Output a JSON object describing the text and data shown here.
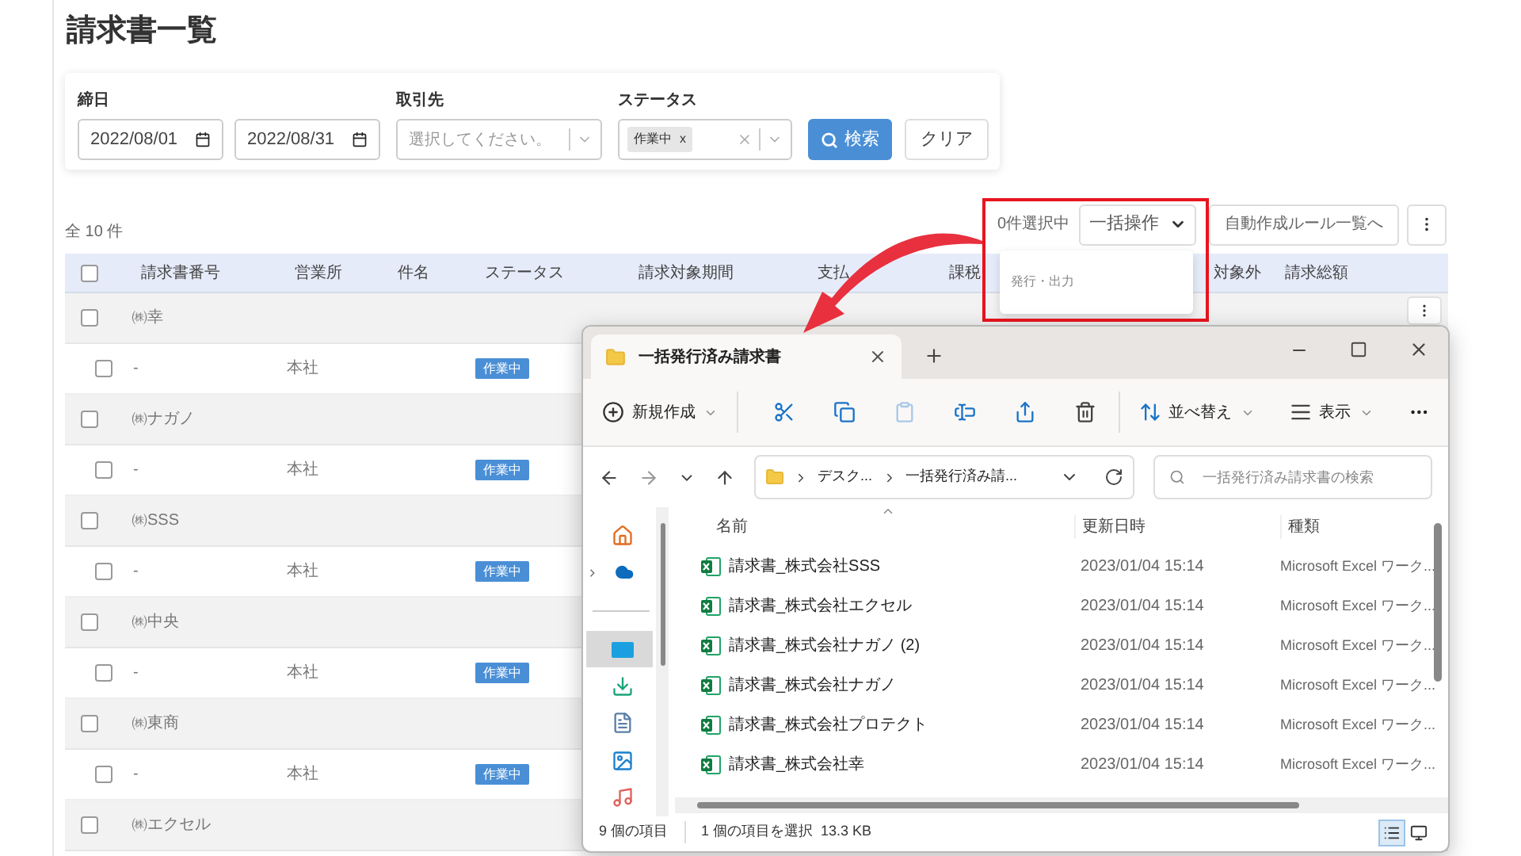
{
  "page": {
    "title": "請求書一覧"
  },
  "filters": {
    "closing_date": {
      "label": "締日",
      "from": "2022/08/01",
      "to": "2022/08/31"
    },
    "client": {
      "label": "取引先",
      "placeholder": "選択してください。"
    },
    "status": {
      "label": "ステータス",
      "tags": [
        {
          "label": "作業中",
          "remove": "x"
        }
      ]
    },
    "search_button": "検索",
    "clear_button": "クリア"
  },
  "total": "全 10 件",
  "toolbar": {
    "selected_count": "0件選択中",
    "bulk_button": "一括操作",
    "rules_button": "自動作成ルール一覧へ"
  },
  "bulk_menu": {
    "expanded": true,
    "items": [
      "発行・出力"
    ]
  },
  "table": {
    "header_checked": false,
    "columns": [
      "請求書番号",
      "営業所",
      "件名",
      "ステータス",
      "請求対象期間",
      "支払",
      "課税",
      "対象外",
      "請求総額"
    ],
    "rows": [
      {
        "kind": "group",
        "name": "㈱幸",
        "checked": false,
        "has_menu": true
      },
      {
        "kind": "item",
        "number": "-",
        "office": "本社",
        "status": "作業中",
        "checked": false
      },
      {
        "kind": "group",
        "name": "㈱ナガノ",
        "checked": false
      },
      {
        "kind": "item",
        "number": "-",
        "office": "本社",
        "status": "作業中",
        "checked": false
      },
      {
        "kind": "group",
        "name": "㈱SSS",
        "checked": false
      },
      {
        "kind": "item",
        "number": "-",
        "office": "本社",
        "status": "作業中",
        "checked": false
      },
      {
        "kind": "group",
        "name": "㈱中央",
        "checked": false
      },
      {
        "kind": "item",
        "number": "-",
        "office": "本社",
        "status": "作業中",
        "checked": false
      },
      {
        "kind": "group",
        "name": "㈱東商",
        "checked": false
      },
      {
        "kind": "item",
        "number": "-",
        "office": "本社",
        "status": "作業中",
        "checked": false
      },
      {
        "kind": "group",
        "name": "㈱エクセル",
        "checked": false
      }
    ]
  },
  "explorer": {
    "tab_title": "一括発行済み請求書",
    "commands": {
      "new": "新規作成",
      "sort": "並べ替え",
      "view": "表示"
    },
    "breadcrumb": [
      "デスク...",
      "一括発行済み請..."
    ],
    "search": {
      "placeholder": "一括発行済み請求書の検索"
    },
    "nav": [
      {
        "kind": "home",
        "selected": false
      },
      {
        "kind": "cloud",
        "selected": false
      },
      {
        "kind": "divider"
      },
      {
        "kind": "desktop",
        "selected": true
      },
      {
        "kind": "download",
        "selected": false
      },
      {
        "kind": "document",
        "selected": false
      },
      {
        "kind": "picture",
        "selected": false
      },
      {
        "kind": "music",
        "selected": false
      }
    ],
    "columns": [
      "名前",
      "更新日時",
      "種類"
    ],
    "files": [
      {
        "name": "請求書_株式会社SSS",
        "modified": "2023/01/04 15:14",
        "type": "Microsoft Excel ワーク..."
      },
      {
        "name": "請求書_株式会社エクセル",
        "modified": "2023/01/04 15:14",
        "type": "Microsoft Excel ワーク..."
      },
      {
        "name": "請求書_株式会社ナガノ (2)",
        "modified": "2023/01/04 15:14",
        "type": "Microsoft Excel ワーク..."
      },
      {
        "name": "請求書_株式会社ナガノ",
        "modified": "2023/01/04 15:14",
        "type": "Microsoft Excel ワーク..."
      },
      {
        "name": "請求書_株式会社プロテクト",
        "modified": "2023/01/04 15:14",
        "type": "Microsoft Excel ワーク..."
      },
      {
        "name": "請求書_株式会社幸",
        "modified": "2023/01/04 15:14",
        "type": "Microsoft Excel ワーク..."
      }
    ],
    "status": {
      "count": "9 個の項目",
      "selection": "1 個の項目を選択  13.3 KB"
    },
    "view_modes": [
      {
        "kind": "details",
        "selected": true
      },
      {
        "kind": "tiles",
        "selected": false
      }
    ]
  }
}
